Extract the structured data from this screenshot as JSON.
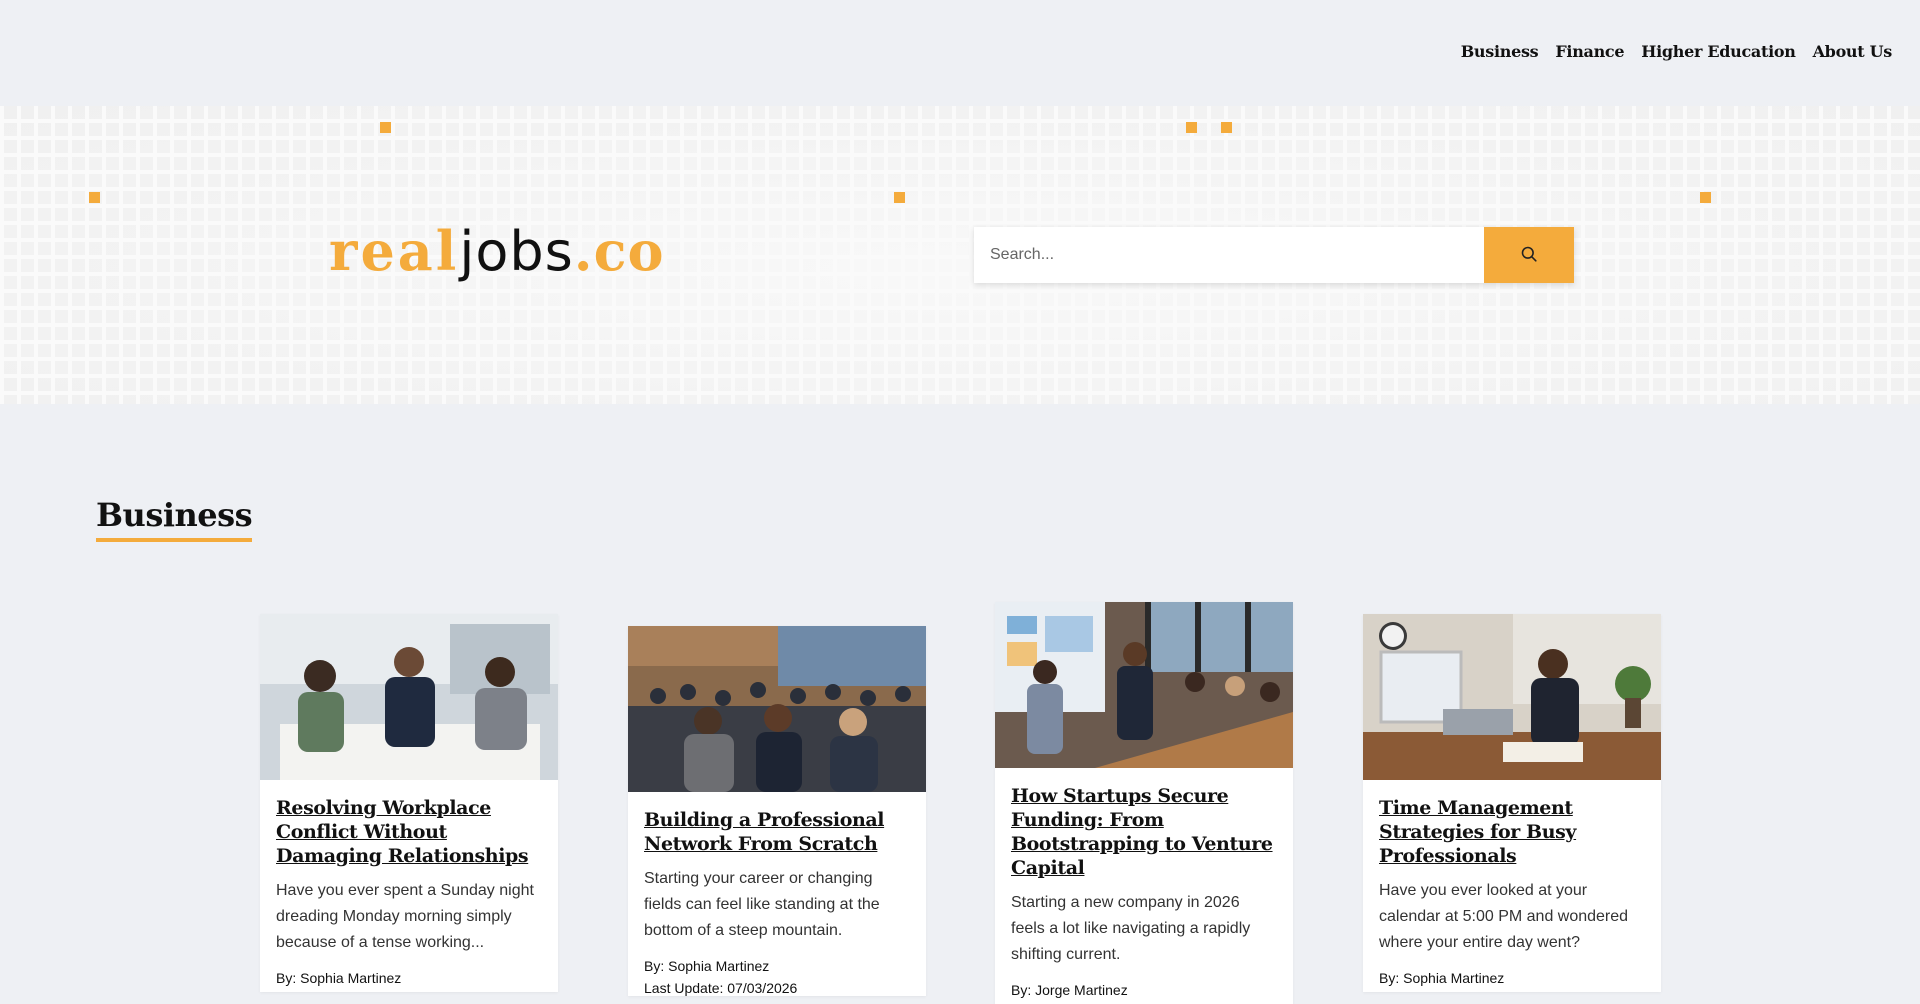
{
  "nav": {
    "items": [
      "Business",
      "Finance",
      "Higher Education",
      "About Us"
    ]
  },
  "brand": {
    "part1": "real",
    "part2": "jobs",
    "part3": ".co",
    "accent_color": "#f4ab3c"
  },
  "search": {
    "placeholder": "Search...",
    "icon": "search-icon"
  },
  "section": {
    "title": "Business"
  },
  "cards": [
    {
      "title": "Resolving Workplace Conflict Without Damaging Relationships",
      "excerpt": "Have you ever spent a Sunday night dreading Monday morning simply because of a tense working...",
      "author": "By: Sophia Martinez",
      "updated": ""
    },
    {
      "title": "Building a Professional Network From Scratch",
      "excerpt": "Starting your career or changing fields can feel like standing at the bottom of a steep mountain.",
      "author": "By: Sophia Martinez",
      "updated": "Last Update: 07/03/2026"
    },
    {
      "title": "How Startups Secure Funding: From Bootstrapping to Venture Capital",
      "excerpt": "Starting a new company in 2026 feels a lot like navigating a rapidly shifting current.",
      "author": "By: Jorge Martinez",
      "updated": ""
    },
    {
      "title": "Time Management Strategies for Busy Professionals",
      "excerpt": "Have you ever looked at your calendar at 5:00 PM and wondered where your entire day went?",
      "author": "By: Sophia Martinez",
      "updated": ""
    }
  ]
}
